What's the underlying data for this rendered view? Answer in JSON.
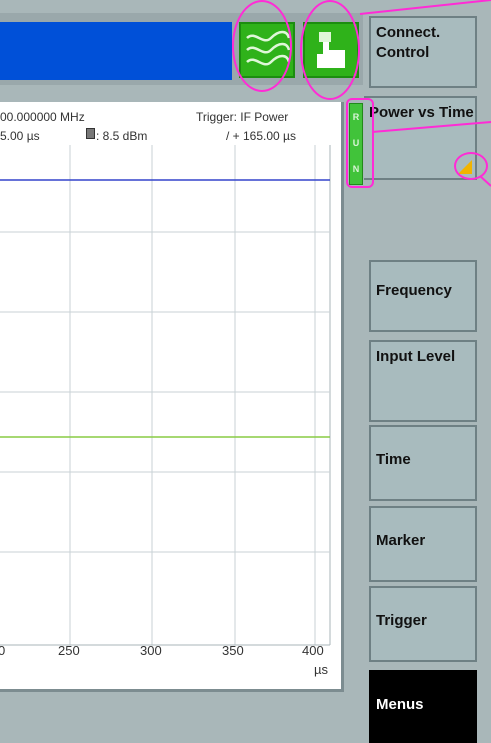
{
  "header": {
    "center_frequency": "00.000000  MHz",
    "trigger": "Trigger: IF Power",
    "sweep_time": "5.00  µs",
    "ref_level": ": 8.5  dBm",
    "marker_delta": "/ + 165.00  µs"
  },
  "status": {
    "run_letters": [
      "R",
      "U",
      "N"
    ]
  },
  "axis": {
    "x_ticks": [
      "0",
      "250",
      "300",
      "350",
      "400"
    ],
    "x_unit": "µs"
  },
  "softkeys": {
    "connect_control": "Connect. Control",
    "power_vs_time": "Power vs Time",
    "frequency": "Frequency",
    "input_level": "Input Level",
    "time": "Time",
    "marker": "Marker",
    "trigger": "Trigger",
    "menus": "Menus"
  },
  "icons": {
    "generator": "sine-wave-icon",
    "remote": "hand-pointer-icon"
  },
  "colors": {
    "title_blue": "#0050d8",
    "status_green": "#2fb21a",
    "annotation": "#ff2bd6",
    "trace_blue": "#3344cc",
    "trace_green": "#88cc44"
  }
}
